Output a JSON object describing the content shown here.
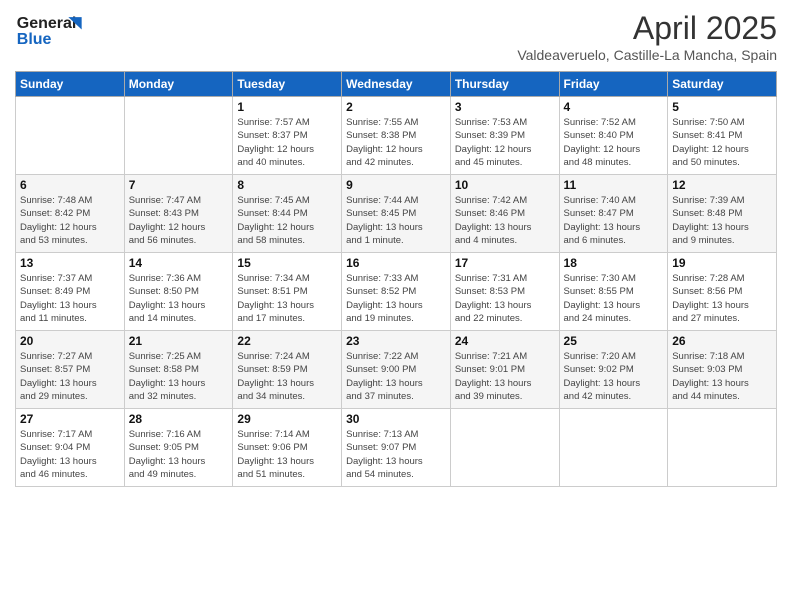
{
  "header": {
    "logo_line1": "General",
    "logo_line2": "Blue",
    "title": "April 2025",
    "subtitle": "Valdeaveruelo, Castille-La Mancha, Spain"
  },
  "days_of_week": [
    "Sunday",
    "Monday",
    "Tuesday",
    "Wednesday",
    "Thursday",
    "Friday",
    "Saturday"
  ],
  "weeks": [
    [
      {
        "day": "",
        "info": ""
      },
      {
        "day": "",
        "info": ""
      },
      {
        "day": "1",
        "info": "Sunrise: 7:57 AM\nSunset: 8:37 PM\nDaylight: 12 hours\nand 40 minutes."
      },
      {
        "day": "2",
        "info": "Sunrise: 7:55 AM\nSunset: 8:38 PM\nDaylight: 12 hours\nand 42 minutes."
      },
      {
        "day": "3",
        "info": "Sunrise: 7:53 AM\nSunset: 8:39 PM\nDaylight: 12 hours\nand 45 minutes."
      },
      {
        "day": "4",
        "info": "Sunrise: 7:52 AM\nSunset: 8:40 PM\nDaylight: 12 hours\nand 48 minutes."
      },
      {
        "day": "5",
        "info": "Sunrise: 7:50 AM\nSunset: 8:41 PM\nDaylight: 12 hours\nand 50 minutes."
      }
    ],
    [
      {
        "day": "6",
        "info": "Sunrise: 7:48 AM\nSunset: 8:42 PM\nDaylight: 12 hours\nand 53 minutes."
      },
      {
        "day": "7",
        "info": "Sunrise: 7:47 AM\nSunset: 8:43 PM\nDaylight: 12 hours\nand 56 minutes."
      },
      {
        "day": "8",
        "info": "Sunrise: 7:45 AM\nSunset: 8:44 PM\nDaylight: 12 hours\nand 58 minutes."
      },
      {
        "day": "9",
        "info": "Sunrise: 7:44 AM\nSunset: 8:45 PM\nDaylight: 13 hours\nand 1 minute."
      },
      {
        "day": "10",
        "info": "Sunrise: 7:42 AM\nSunset: 8:46 PM\nDaylight: 13 hours\nand 4 minutes."
      },
      {
        "day": "11",
        "info": "Sunrise: 7:40 AM\nSunset: 8:47 PM\nDaylight: 13 hours\nand 6 minutes."
      },
      {
        "day": "12",
        "info": "Sunrise: 7:39 AM\nSunset: 8:48 PM\nDaylight: 13 hours\nand 9 minutes."
      }
    ],
    [
      {
        "day": "13",
        "info": "Sunrise: 7:37 AM\nSunset: 8:49 PM\nDaylight: 13 hours\nand 11 minutes."
      },
      {
        "day": "14",
        "info": "Sunrise: 7:36 AM\nSunset: 8:50 PM\nDaylight: 13 hours\nand 14 minutes."
      },
      {
        "day": "15",
        "info": "Sunrise: 7:34 AM\nSunset: 8:51 PM\nDaylight: 13 hours\nand 17 minutes."
      },
      {
        "day": "16",
        "info": "Sunrise: 7:33 AM\nSunset: 8:52 PM\nDaylight: 13 hours\nand 19 minutes."
      },
      {
        "day": "17",
        "info": "Sunrise: 7:31 AM\nSunset: 8:53 PM\nDaylight: 13 hours\nand 22 minutes."
      },
      {
        "day": "18",
        "info": "Sunrise: 7:30 AM\nSunset: 8:55 PM\nDaylight: 13 hours\nand 24 minutes."
      },
      {
        "day": "19",
        "info": "Sunrise: 7:28 AM\nSunset: 8:56 PM\nDaylight: 13 hours\nand 27 minutes."
      }
    ],
    [
      {
        "day": "20",
        "info": "Sunrise: 7:27 AM\nSunset: 8:57 PM\nDaylight: 13 hours\nand 29 minutes."
      },
      {
        "day": "21",
        "info": "Sunrise: 7:25 AM\nSunset: 8:58 PM\nDaylight: 13 hours\nand 32 minutes."
      },
      {
        "day": "22",
        "info": "Sunrise: 7:24 AM\nSunset: 8:59 PM\nDaylight: 13 hours\nand 34 minutes."
      },
      {
        "day": "23",
        "info": "Sunrise: 7:22 AM\nSunset: 9:00 PM\nDaylight: 13 hours\nand 37 minutes."
      },
      {
        "day": "24",
        "info": "Sunrise: 7:21 AM\nSunset: 9:01 PM\nDaylight: 13 hours\nand 39 minutes."
      },
      {
        "day": "25",
        "info": "Sunrise: 7:20 AM\nSunset: 9:02 PM\nDaylight: 13 hours\nand 42 minutes."
      },
      {
        "day": "26",
        "info": "Sunrise: 7:18 AM\nSunset: 9:03 PM\nDaylight: 13 hours\nand 44 minutes."
      }
    ],
    [
      {
        "day": "27",
        "info": "Sunrise: 7:17 AM\nSunset: 9:04 PM\nDaylight: 13 hours\nand 46 minutes."
      },
      {
        "day": "28",
        "info": "Sunrise: 7:16 AM\nSunset: 9:05 PM\nDaylight: 13 hours\nand 49 minutes."
      },
      {
        "day": "29",
        "info": "Sunrise: 7:14 AM\nSunset: 9:06 PM\nDaylight: 13 hours\nand 51 minutes."
      },
      {
        "day": "30",
        "info": "Sunrise: 7:13 AM\nSunset: 9:07 PM\nDaylight: 13 hours\nand 54 minutes."
      },
      {
        "day": "",
        "info": ""
      },
      {
        "day": "",
        "info": ""
      },
      {
        "day": "",
        "info": ""
      }
    ]
  ]
}
